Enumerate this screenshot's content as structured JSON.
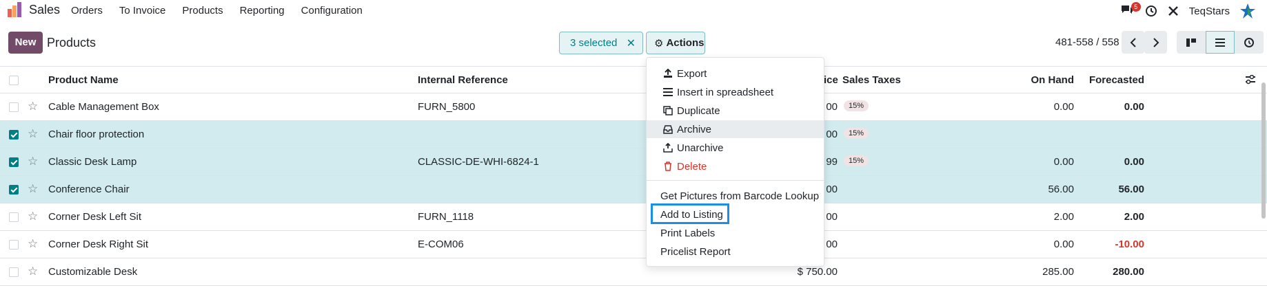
{
  "nav": {
    "brand": "Sales",
    "menu": [
      "Orders",
      "To Invoice",
      "Products",
      "Reporting",
      "Configuration"
    ],
    "chat_badge": "5",
    "company": "TeqStars"
  },
  "control": {
    "new_label": "New",
    "title": "Products",
    "selected_label": "3 selected",
    "actions_label": "Actions",
    "pager": "481-558 / 558"
  },
  "table": {
    "headers": {
      "name": "Product Name",
      "ref": "Internal Reference",
      "price": "ice",
      "taxes": "Sales Taxes",
      "onhand": "On Hand",
      "forecast": "Forecasted"
    },
    "rows": [
      {
        "name": "Cable Management Box",
        "ref": "FURN_5800",
        "price": "00",
        "tax": "15%",
        "onhand": "0.00",
        "forecast": "0.00",
        "checked": false
      },
      {
        "name": "Chair floor protection",
        "ref": "",
        "price": "00",
        "tax": "15%",
        "onhand": "",
        "forecast": "",
        "checked": true
      },
      {
        "name": "Classic Desk Lamp",
        "ref": "CLASSIC-DE-WHI-6824-1",
        "price": "99",
        "tax": "15%",
        "onhand": "0.00",
        "forecast": "0.00",
        "checked": true
      },
      {
        "name": "Conference Chair",
        "ref": "",
        "price": "00",
        "tax": "",
        "onhand": "56.00",
        "forecast": "56.00",
        "checked": true
      },
      {
        "name": "Corner Desk Left Sit",
        "ref": "FURN_1118",
        "price": "00",
        "tax": "",
        "onhand": "2.00",
        "forecast": "2.00",
        "checked": false
      },
      {
        "name": "Corner Desk Right Sit",
        "ref": "E-COM06",
        "price": "00",
        "tax": "",
        "onhand": "0.00",
        "forecast": "-10.00",
        "checked": false
      },
      {
        "name": "Customizable Desk",
        "ref": "",
        "price": "$ 750.00",
        "tax": "",
        "onhand": "285.00",
        "forecast": "280.00",
        "checked": false
      }
    ]
  },
  "dropdown": {
    "group1": [
      "Export",
      "Insert in spreadsheet",
      "Duplicate",
      "Archive",
      "Unarchive",
      "Delete"
    ],
    "group2": [
      "Get Pictures from Barcode Lookup",
      "Add to Listing",
      "Print Labels",
      "Pricelist Report"
    ]
  },
  "colors": {
    "brand_purple": "#714b67",
    "teal": "#017e84",
    "selected_row": "#d1ebee",
    "danger": "#d9342b",
    "highlight": "#1a8fe3"
  }
}
